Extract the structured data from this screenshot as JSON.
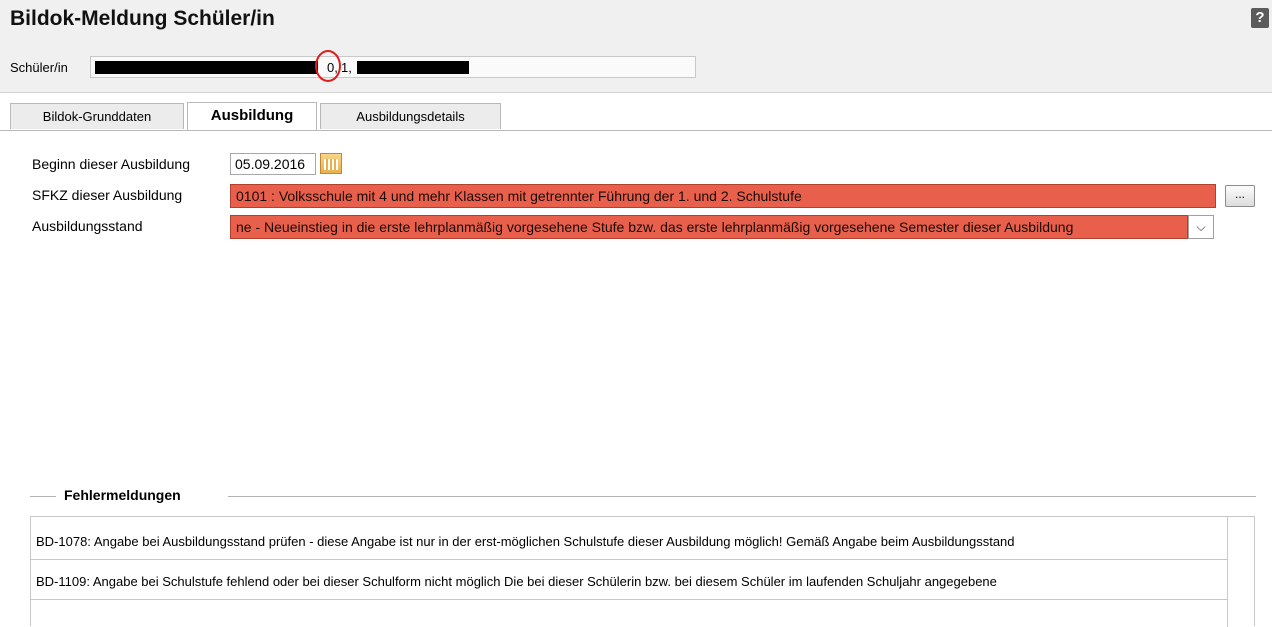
{
  "header": {
    "title": "Bildok-Meldung Schüler/in",
    "help_icon": "?"
  },
  "student": {
    "label": "Schüler/in",
    "visible_fragment_a": "0,",
    "visible_fragment_b": "1,"
  },
  "tabs": [
    {
      "label": "Bildok-Grunddaten"
    },
    {
      "label": "Ausbildung"
    },
    {
      "label": "Ausbildungsdetails"
    }
  ],
  "form": {
    "begin_label": "Beginn dieser Ausbildung",
    "begin_value": "05.09.2016",
    "sfkz_label": "SFKZ dieser Ausbildung",
    "sfkz_value": "0101 : Volksschule mit 4 und mehr Klassen mit getrennter Führung der 1. und 2. Schulstufe",
    "sfkz_button": "...",
    "stand_label": "Ausbildungsstand",
    "stand_value": "ne - Neueinstieg in die erste lehrplanmäßig vorgesehene Stufe bzw. das erste lehrplanmäßig vorgesehene Semester dieser Ausbildung",
    "stand_arrow": "⌵"
  },
  "errors": {
    "legend": "Fehlermeldungen",
    "rows": [
      "BD-1078: Angabe bei Ausbildungsstand prüfen - diese Angabe ist nur in der erst-möglichen Schulstufe dieser Ausbildung möglich! Gemäß Angabe beim Ausbildungsstand",
      "BD-1109: Angabe bei Schulstufe fehlend oder bei dieser Schulform nicht möglich Die bei dieser Schülerin bzw. bei diesem Schüler im laufenden Schuljahr angegebene"
    ]
  },
  "colors": {
    "error_field": "#e8604c",
    "annotation_circle": "#e21b1b"
  }
}
